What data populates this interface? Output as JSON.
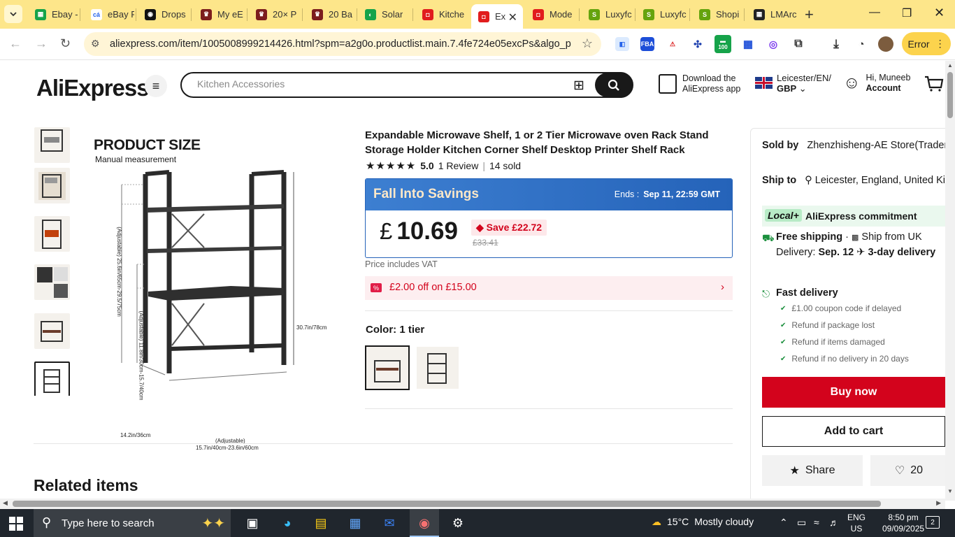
{
  "browser": {
    "tabs": [
      {
        "title": "Ebay -",
        "color": "#16a34a",
        "glyph": "▦"
      },
      {
        "title": "eBay F",
        "color": "#ffffff",
        "glyph": "cá"
      },
      {
        "title": "Drops",
        "color": "#111111",
        "glyph": "◉"
      },
      {
        "title": "My eE",
        "color": "#7c1d1d",
        "glyph": "♛"
      },
      {
        "title": "20× P",
        "color": "#7c1d1d",
        "glyph": "♛"
      },
      {
        "title": "20 Ba",
        "color": "#7c1d1d",
        "glyph": "♛"
      },
      {
        "title": "Solar",
        "color": "#16a34a",
        "glyph": "◐"
      },
      {
        "title": "Kitche",
        "color": "#e11d1d",
        "glyph": "◘"
      },
      {
        "title": "Ex",
        "color": "#e11d1d",
        "glyph": "◘",
        "active": true
      },
      {
        "title": "Mode",
        "color": "#e11d1d",
        "glyph": "◘"
      },
      {
        "title": "Luxyfc",
        "color": "#65a30d",
        "glyph": "S"
      },
      {
        "title": "Luxyfc",
        "color": "#65a30d",
        "glyph": "S"
      },
      {
        "title": "Shopi",
        "color": "#65a30d",
        "glyph": "S"
      },
      {
        "title": "LMArc",
        "color": "#222222",
        "glyph": "▦"
      }
    ],
    "url": "aliexpress.com/item/1005008999214426.html?spm=a2g0o.productlist.main.7.4fe724e05excPs&algo_pvid...",
    "error_label": "Error",
    "extension_badge": "100"
  },
  "site": {
    "logo": "AliExpress",
    "search_placeholder": "Kitchen Accessories",
    "app_download": [
      "Download the",
      "AliExpress app"
    ],
    "locale": [
      "Leicester/EN/",
      "GBP"
    ],
    "account": [
      "Hi, Muneeb",
      "Account"
    ]
  },
  "gallery": {
    "image_title": "PRODUCT SIZE",
    "image_subtitle": "Manual measurement",
    "dims": {
      "height_total": "30.7in/78cm",
      "adj_top": "(Adjustable) 25.6in/65cm-29.5/75cm",
      "adj_mid": "(Adjustable) 11.8in/30cm-15.7/40cm",
      "depth": "14.2in/36cm",
      "width_label": "(Adjustable)",
      "width": "15.7in/40cm-23.6in/60cm"
    }
  },
  "product": {
    "title": "Expandable Microwave Shelf, 1 or 2 Tier Microwave oven Rack Stand Storage Holder Kitchen Corner Shelf Desktop Printer Shelf Rack",
    "rating": "5.0",
    "reviews": "1 Review",
    "sold": "14 sold",
    "sale_name": "Fall Into Savings",
    "ends_label": "Ends :",
    "ends_value": "Sep 11, 22:59 GMT",
    "currency": "£",
    "price": "10.69",
    "save": "Save £22.72",
    "original_price": "£33.41",
    "vat_note": "Price includes VAT",
    "coupon": "£2.00 off on £15.00",
    "color_label": "Color: 1 tier"
  },
  "panel": {
    "sold_by_label": "Sold by",
    "sold_by": "Zhenzhisheng-AE Store(Trader)",
    "ship_to_label": "Ship to",
    "ship_to": "Leicester, England, United Ki...",
    "commitment_badge": "Local+",
    "commitment": "AliExpress commitment",
    "free_shipping": "Free shipping",
    "ship_from": "Ship from UK",
    "delivery_label": "Delivery:",
    "delivery_date": "Sep. 12",
    "delivery_speed": "3-day delivery",
    "fast_delivery": "Fast delivery",
    "guarantees": [
      "£1.00 coupon code if delayed",
      "Refund if package lost",
      "Refund if items damaged",
      "Refund if no delivery in 20 days"
    ],
    "buy_now": "Buy now",
    "add_to_cart": "Add to cart",
    "share": "Share",
    "wishlist_count": "20"
  },
  "related_title": "Related items",
  "taskbar": {
    "search_placeholder": "Type here to search",
    "temperature": "15°C",
    "weather": "Mostly cloudy",
    "lang": [
      "ENG",
      "US"
    ],
    "time": "8:50 pm",
    "date": "09/09/2025",
    "notifications": "2"
  }
}
